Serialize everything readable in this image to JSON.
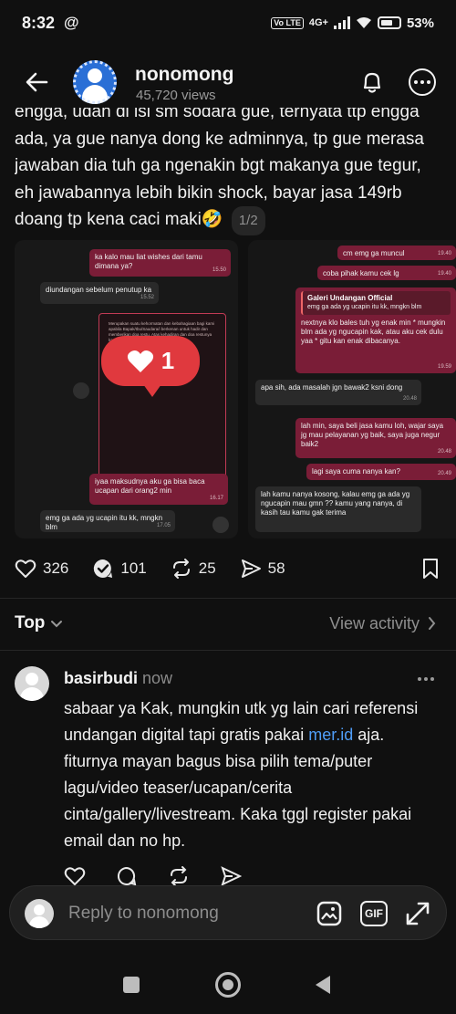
{
  "status_bar": {
    "time": "8:32",
    "network_chip": "Vo LTE",
    "network": "4G+",
    "battery": "53%"
  },
  "header": {
    "username": "nonomong",
    "views": "45,720 views"
  },
  "post": {
    "text": "engga, udah di isi sm sodara gue, ternyata ttp engga ada, ya gue nanya dong ke adminnya, tp gue merasa jawaban dia tuh ga ngenakin bgt makanya gue tegur, eh jawabannya lebih bikin shock, bayar jasa 149rb doang tp kena caci maki🤣",
    "page_indicator": "1/2"
  },
  "image1": {
    "overlay_like_count": "1",
    "messages": [
      {
        "text": "ka kalo mau liat wishes dari tamu dimana ya?",
        "time": "15.50"
      },
      {
        "text": "diundangan sebelum penutup ka",
        "time": "15.52"
      },
      {
        "text": "iyaa maksudnya aku ga bisa baca ucapan dari orang2 min",
        "time": "16.17"
      },
      {
        "text": "emg ga ada yg ucapin itu kk, mngkn blm",
        "time": "17.05"
      }
    ]
  },
  "image2": {
    "messages": [
      {
        "text": "cm emg ga muncul",
        "time": "19.40"
      },
      {
        "text": "coba pihak kamu cek lg",
        "time": "19.40"
      },
      {
        "reply_name": "Galeri Undangan Official",
        "reply_quote": "emg ga ada yg ucapin itu kk, mngkn blm",
        "text": "nextnya klo bales tuh yg enak min * mungkin blm ada yg ngucapin kak, atau aku cek dulu yaa * gitu kan enak dibacanya.",
        "time": "19.59"
      },
      {
        "text": "apa sih, ada masalah jgn bawak2 ksni dong",
        "time": "20.48"
      },
      {
        "text": "lah min, saya beli jasa kamu loh, wajar saya jg mau pelayanan yg baik, saya juga negur baik2",
        "time": "20.48"
      },
      {
        "text": "lagi saya cuma nanya kan?",
        "time": "20.49"
      },
      {
        "text": "lah kamu nanya kosong, kalau emg ga ada yg ngucapin mau gmn ?? kamu yang nanya, di kasih tau kamu gak terima",
        "time": ""
      }
    ]
  },
  "actions": {
    "likes": "326",
    "comments": "101",
    "reposts": "25",
    "shares": "58"
  },
  "filter": {
    "sort_label": "Top",
    "view_activity": "View activity"
  },
  "comment": {
    "username": "basirbudi",
    "timestamp": "now",
    "text_before_link": "sabaar ya Kak, mungkin utk yg lain cari referensi undangan digital tapi gratis pakai ",
    "link": "mer.id",
    "text_after_link": " aja. fiturnya mayan bagus bisa pilih tema/puter lagu/video teaser/ucapan/cerita cinta/gallery/livestream. Kaka tggl register pakai email dan no hp."
  },
  "reply_bar": {
    "placeholder": "Reply to nonomong",
    "gif_label": "GIF"
  },
  "colors": {
    "background": "#101010",
    "like_bubble": "#e0393e",
    "link": "#4f9df7",
    "outgoing_bubble": "#7a1d37"
  }
}
